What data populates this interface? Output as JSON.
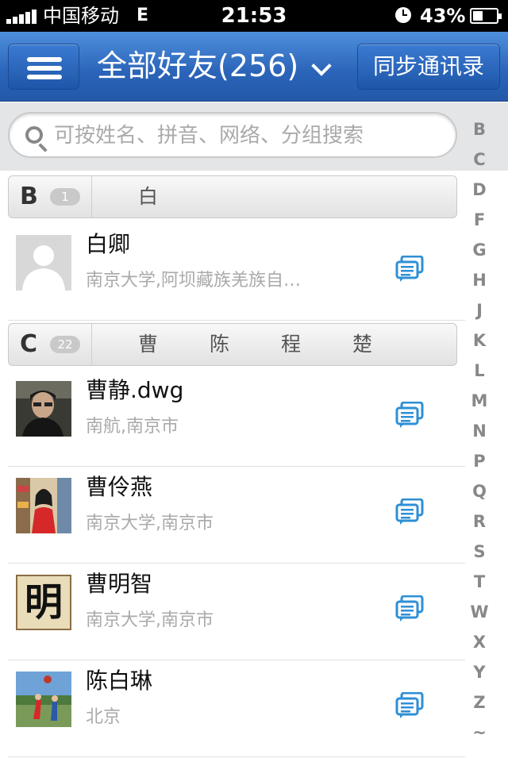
{
  "status_bar": {
    "carrier": "中国移动",
    "network": "E",
    "time": "21:53",
    "battery": "43%",
    "battery_level": 0.43
  },
  "nav": {
    "title": "全部好友(256)",
    "sync_button": "同步通讯录",
    "bar_color": "#2a63b8"
  },
  "search": {
    "placeholder": "可按姓名、拼音、网络、分组搜索"
  },
  "alpha_index": [
    "B",
    "C",
    "D",
    "F",
    "G",
    "H",
    "J",
    "K",
    "L",
    "M",
    "N",
    "P",
    "Q",
    "R",
    "S",
    "T",
    "W",
    "X",
    "Y",
    "Z",
    "~"
  ],
  "sections": [
    {
      "letter": "B",
      "count": "1",
      "names": [
        "白"
      ],
      "contacts": [
        {
          "name": "白卿",
          "sub": "南京大学,阿坝藏族羌族自…",
          "avatar": "default-avatar"
        }
      ]
    },
    {
      "letter": "C",
      "count": "22",
      "names": [
        "曹",
        "陈",
        "程",
        "楚"
      ],
      "contacts": [
        {
          "name": "曹静.dwg",
          "sub": "南航,南京市",
          "avatar": "photo-portrait"
        },
        {
          "name": "曹伶燕",
          "sub": "南京大学,南京市",
          "avatar": "photo-girl"
        },
        {
          "name": "曹明智",
          "sub": "南京大学,南京市",
          "avatar": "calligraphy-avatar",
          "avatar_char": "明"
        },
        {
          "name": "陈白琳",
          "sub": "北京",
          "avatar": "photo-outdoor"
        }
      ]
    }
  ],
  "colors": {
    "accent": "#2e8fd6",
    "secondary_text": "#aaaaaa"
  }
}
